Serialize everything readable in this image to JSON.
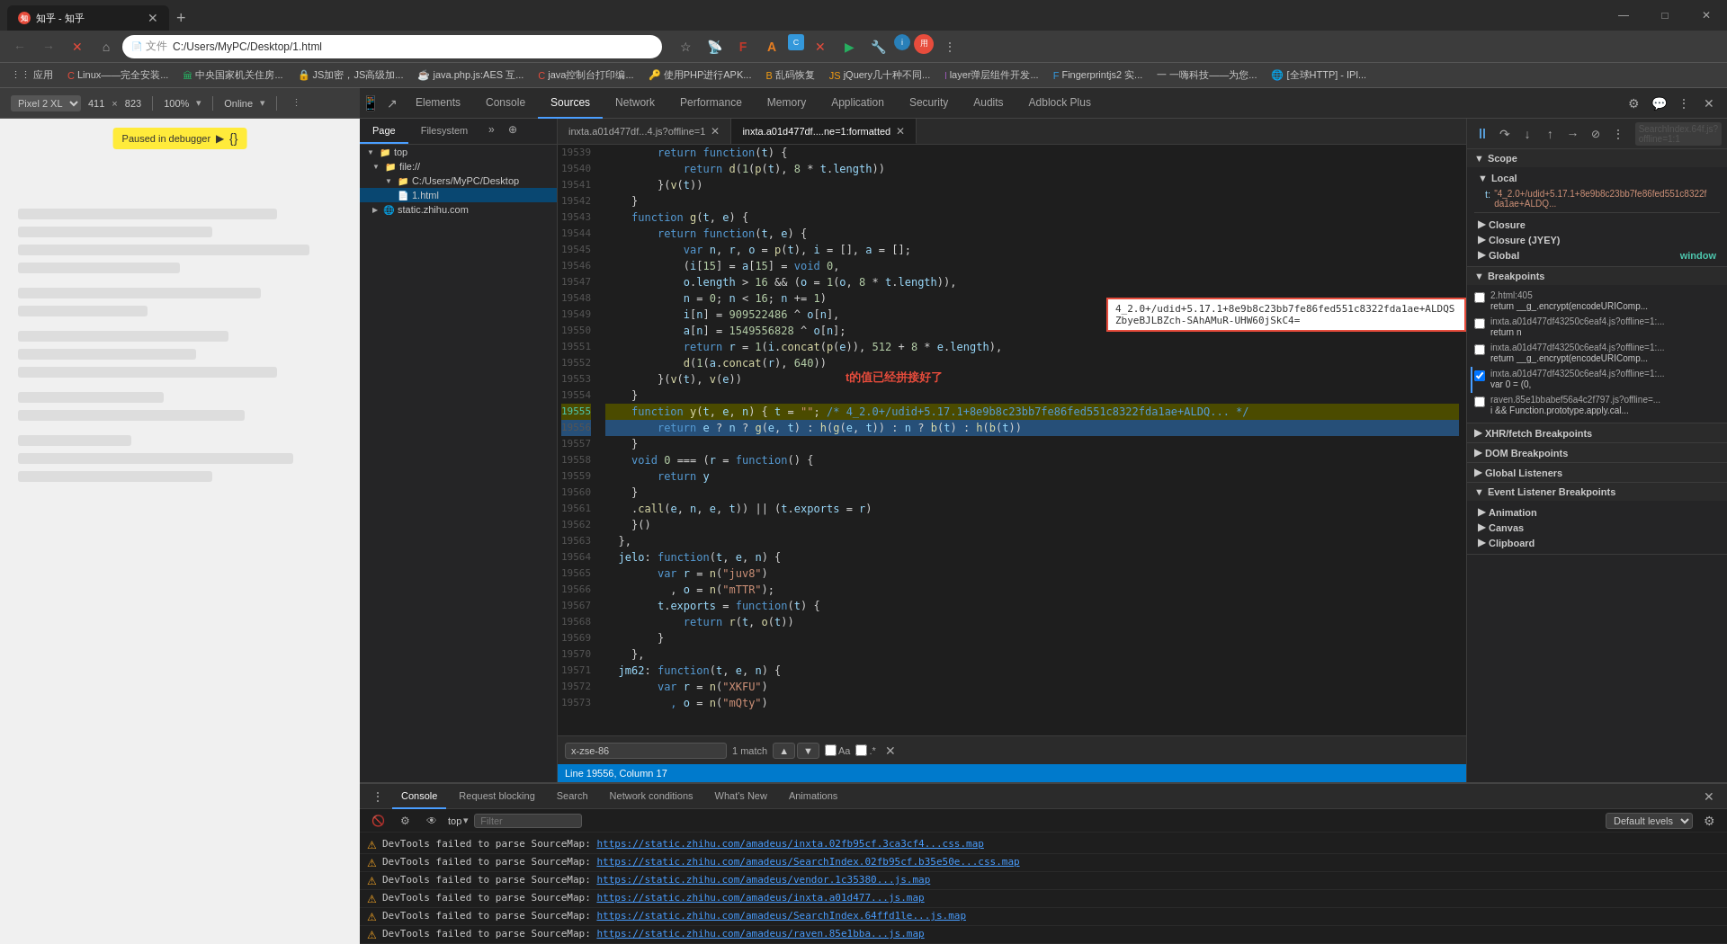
{
  "browser": {
    "tab_title": "知乎 - 知乎",
    "url": "C:/Users/MyPC/Desktop/1.html",
    "url_prefix": "文件",
    "window_controls": {
      "minimize": "—",
      "maximize": "□",
      "close": "✕"
    }
  },
  "bookmarks": [
    {
      "label": "应用"
    },
    {
      "label": "Linux——完全安装..."
    },
    {
      "label": "中央国家机关住房..."
    },
    {
      "label": "JS加密，JS高级加..."
    },
    {
      "label": "java.php.js:AES 互..."
    },
    {
      "label": "java控制台打印编..."
    },
    {
      "label": "使用PHP进行APK..."
    },
    {
      "label": "乱码恢复"
    },
    {
      "label": "jQuery几十种不同..."
    },
    {
      "label": "layer弹层组件开发..."
    },
    {
      "label": "Fingerprintjs2 实..."
    },
    {
      "label": "一嗨科技——为您..."
    },
    {
      "label": "[全球HTTP] - IPl..."
    }
  ],
  "devtools": {
    "toolbar_tabs": [
      "Elements",
      "Console",
      "Sources",
      "Network",
      "Performance",
      "Memory",
      "Application",
      "Security",
      "Audits",
      "Adblock Plus"
    ],
    "active_tab": "Sources",
    "device": "Pixel 2 XL",
    "dimensions": "411 × 823",
    "zoom": "100%",
    "mode": "Online"
  },
  "sources_panel": {
    "page_tab": "Page",
    "filesystem_tab": "Filesystem",
    "tree": {
      "top_label": "top",
      "file_label": "file://",
      "folder_label": "C:/Users/MyPC/Desktop",
      "file1_label": "1.html",
      "domain_label": "static.zhihu.com"
    },
    "editor_tabs": [
      {
        "label": "inxta.a01d477df...4.js?offline=1",
        "active": false
      },
      {
        "label": "inxta.a01d477df....ne=1:formatted",
        "active": true
      }
    ]
  },
  "code": {
    "lines": [
      {
        "num": "19539",
        "text": "        return function(t) {"
      },
      {
        "num": "19540",
        "text": "            return d(1(p(t), 8 * t.length))"
      },
      {
        "num": "19541",
        "text": "        }(v(t))"
      },
      {
        "num": "19542",
        "text": "    }"
      },
      {
        "num": "19543",
        "text": "    function g(t, e) {"
      },
      {
        "num": "19544",
        "text": "        return function(t, e) {"
      },
      {
        "num": "19545",
        "text": "            var n, r, o = p(t), i = [], a = [];"
      },
      {
        "num": "19546",
        "text": "            (i[15] = a[15] = void 0,"
      },
      {
        "num": "19547",
        "text": "            o.length > 16 && (o = 1(o, 8 * t.length)),"
      },
      {
        "num": "19548",
        "text": "            n = 0; n < 16; n += 1)"
      },
      {
        "num": "19549",
        "text": "            i[n] = 909522486 ^ o[n],"
      },
      {
        "num": "19550",
        "text": "            a[n] = 1549556828 ^ o[n];"
      },
      {
        "num": "19551",
        "text": "            return r = 1(i.concat(p(e)), 512 + 8 * e.length),"
      },
      {
        "num": "19552",
        "text": "            d(1(a.concat(r), 640))"
      },
      {
        "num": "19553",
        "text": "        }(v(t), v(e))"
      },
      {
        "num": "19554",
        "text": "    }"
      },
      {
        "num": "19555",
        "text": "    function y(t, e, n) { t = \"\"; /* 4_2.0+/udid+5.17.1+8e9b8c23bb7fe86fed551c8322fda1ae+ALDQ... */"
      },
      {
        "num": "19556",
        "text": "        return e ? n ? g(e, t) : h(g(e, t)) : n ? b(t) : h(b(t))",
        "highlight": true
      },
      {
        "num": "19557",
        "text": "    }"
      },
      {
        "num": "19558",
        "text": "    void 0 === (r = function() {"
      },
      {
        "num": "19559",
        "text": "        return y"
      },
      {
        "num": "19560",
        "text": "    }"
      },
      {
        "num": "19561",
        "text": "    .call(e, n, e, t)) || (t.exports = r)"
      },
      {
        "num": "19562",
        "text": "    }()"
      },
      {
        "num": "19563",
        "text": "  },"
      },
      {
        "num": "19564",
        "text": "  jelo: function(t, e, n) {"
      },
      {
        "num": "19565",
        "text": "        var r = n(\"juv8\")"
      },
      {
        "num": "19566",
        "text": "          , o = n(\"mTTR\");"
      },
      {
        "num": "19567",
        "text": "        t.exports = function(t) {"
      },
      {
        "num": "19568",
        "text": "            return r(t, o(t))"
      },
      {
        "num": "19569",
        "text": "        }"
      },
      {
        "num": "19570",
        "text": "    },"
      },
      {
        "num": "19571",
        "text": "  jm62: function(t, e, n) {"
      },
      {
        "num": "19572",
        "text": "        var r = n(\"XKFU\")"
      },
      {
        "num": "19573",
        "text": "          , o = n(\"mQty\")"
      }
    ],
    "search_term": "x-zse-86",
    "search_match": "1 match",
    "status_line": "Line 19556, Column 17"
  },
  "value_box": {
    "text": "4_2.0+/udid+5.17.1+8e9b8c23bb7fe86fed551c8322fda1ae+ALDQSZbyeBJLBZch-SAhAMuR-UHW60jSkC4=",
    "comment": "t的值已经拼接好了"
  },
  "debugger": {
    "search_placeholder": "SearchIndex.64f.js?offline=1:1",
    "scope_label": "Scope",
    "local_label": "Local",
    "local_t_key": "t:",
    "local_t_value": "\"4_2.0+/udid+5.17.1+8e9b8c23bb7fe86fed551c8322fda1ae+ALDQ...",
    "closure_label": "Closure",
    "closure_jyey": "Closure (JYEY)",
    "global_label": "Global",
    "global_value": "window",
    "breakpoints_label": "Breakpoints",
    "breakpoints": [
      {
        "file": "2.html:405",
        "code": "return __g_.encrypt(encodeURIComp...",
        "checked": false
      },
      {
        "file": "inxta.a01d477df43250c6eaf4.js?offline=1:...",
        "code": "return n",
        "checked": false
      },
      {
        "file": "inxta.a01d477df43250c6eaf4.js?offline=1:...",
        "code": "return __g_.encrypt(encodeURIComp...",
        "checked": false
      },
      {
        "file": "inxta.a01d477df43250c6eaf4.js?offline=1:...",
        "code": "var 0 = (0,",
        "checked": true,
        "active": true
      },
      {
        "file": "raven.85e1bbabef56a4c2f797.js?offline=...",
        "code": "i && Function.prototype.apply.cal...",
        "checked": false
      }
    ],
    "xhr_fetch_label": "XHR/fetch Breakpoints",
    "dom_label": "DOM Breakpoints",
    "global_listeners_label": "Global Listeners",
    "event_listener_label": "Event Listener Breakpoints",
    "animation_label": "Animation",
    "canvas_label": "Canvas",
    "clipboard_label": "Clipboard"
  },
  "console": {
    "tabs": [
      "Console",
      "Request blocking",
      "Search",
      "Network conditions",
      "What's New",
      "Animations"
    ],
    "active_tab": "Console",
    "top_label": "top",
    "filter_placeholder": "Filter",
    "levels": "Default levels",
    "messages": [
      {
        "type": "warn",
        "text": "DevTools failed to parse SourceMap: ",
        "link": "https://static.zhihu.com/amadeus/inxta.02fb95cf.3ca3cf4...css.map"
      },
      {
        "type": "warn",
        "text": "DevTools failed to parse SourceMap: ",
        "link": "https://static.zhihu.com/amadeus/SearchIndex.02fb95cf.b35e50e...css.map"
      },
      {
        "type": "warn",
        "text": "DevTools failed to parse SourceMap: ",
        "link": "https://static.zhihu.com/amadeus/vendor.1c35380...js.map"
      },
      {
        "type": "warn",
        "text": "DevTools failed to parse SourceMap: ",
        "link": "https://static.zhihu.com/amadeus/inxta.a01d477...js.map"
      },
      {
        "type": "warn",
        "text": "DevTools failed to parse SourceMap: ",
        "link": "https://static.zhihu.com/amadeus/SearchIndex.64ffd1le...js.map"
      },
      {
        "type": "warn",
        "text": "DevTools failed to parse SourceMap: ",
        "link": "https://static.zhihu.com/amadeus/raven.85e1bba...js.map"
      }
    ]
  }
}
